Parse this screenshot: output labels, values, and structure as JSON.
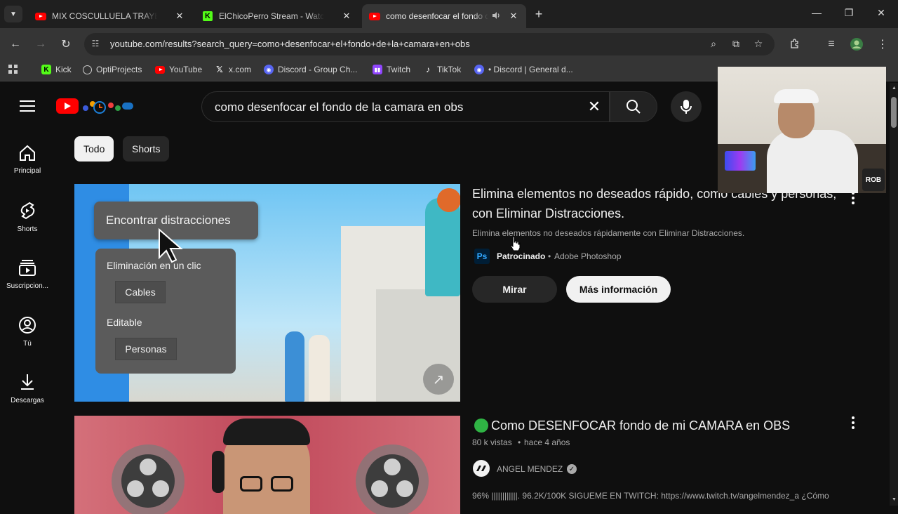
{
  "browser": {
    "tabs": [
      {
        "title": "MIX COSCULLUELA TRAYECTORIA",
        "favicon": "youtube-icon"
      },
      {
        "title": "ElChicoPerro Stream - Watch Live",
        "favicon": "kick-icon"
      },
      {
        "title": "como desenfocar el fondo de la camara",
        "favicon": "youtube-icon",
        "active": true,
        "audio": true
      }
    ],
    "url": "youtube.com/results?search_query=como+desenfocar+el+fondo+de+la+camara+en+obs",
    "bookmarks": [
      {
        "label": "Kick",
        "icon": "kick-icon"
      },
      {
        "label": "OptiProjects",
        "icon": "optiprojects-icon"
      },
      {
        "label": "YouTube",
        "icon": "youtube-icon"
      },
      {
        "label": "x.com",
        "icon": "x-icon"
      },
      {
        "label": "Discord - Group Ch...",
        "icon": "discord-icon"
      },
      {
        "label": "Twitch",
        "icon": "twitch-icon"
      },
      {
        "label": "TikTok",
        "icon": "tiktok-icon"
      },
      {
        "label": "• Discord | General d...",
        "icon": "discord-icon"
      }
    ]
  },
  "youtube": {
    "search_query": "como desenfocar el fondo de la camara en obs",
    "sidebar": [
      {
        "label": "Principal",
        "icon": "home-icon"
      },
      {
        "label": "Shorts",
        "icon": "shorts-icon"
      },
      {
        "label": "Suscripcion...",
        "icon": "subscriptions-icon"
      },
      {
        "label": "Tú",
        "icon": "you-icon"
      },
      {
        "label": "Descargas",
        "icon": "download-icon"
      }
    ],
    "chips": [
      {
        "label": "Todo",
        "selected": true
      },
      {
        "label": "Shorts",
        "selected": false
      }
    ],
    "ad": {
      "title": "Elimina elementos no deseados rápido, como cables y personas, con Eliminar Distracciones.",
      "description": "Elimina elementos no deseados rápidamente con Eliminar Distracciones.",
      "sponsored_label": "Patrocinado",
      "advertiser": "Adobe Photoshop",
      "advertiser_badge": "Ps",
      "watch_button": "Mirar",
      "more_button": "Más información",
      "thumbnail": {
        "find_label": "Encontrar distracciones",
        "one_click_label": "Eliminación en un clic",
        "cables_label": "Cables",
        "editable_label": "Editable",
        "people_label": "Personas"
      }
    },
    "video": {
      "title": "Como DESENFOCAR fondo de mi CAMARA en OBS",
      "views": "80 k vistas",
      "age": "hace 4 años",
      "channel": "ANGEL MENDEZ",
      "description": "96% ||||||||||||. 96.2K/100K SIGUEME EN TWITCH: https://www.twitch.tv/angelmendez_a ¿Cómo"
    },
    "overlay_badge": "ROB"
  }
}
